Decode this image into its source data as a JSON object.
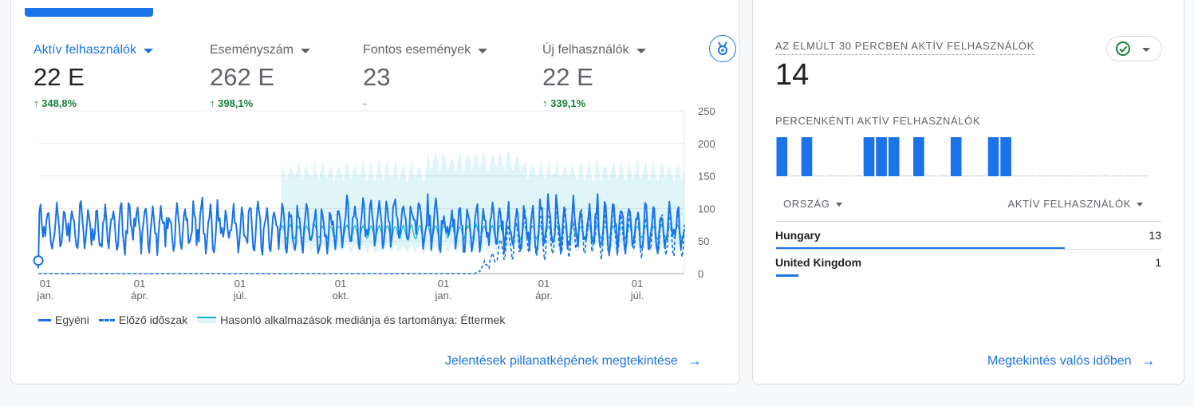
{
  "metrics": [
    {
      "label": "Aktív felhasználók",
      "value": "22 E",
      "delta": "↑ 348,8%",
      "active": true
    },
    {
      "label": "Eseményszám",
      "value": "262 E",
      "delta": "↑ 398,1%"
    },
    {
      "label": "Fontos események",
      "value": "23",
      "delta": "-"
    },
    {
      "label": "Új felhasználók",
      "value": "22 E",
      "delta": "↑ 339,1%"
    }
  ],
  "chart_data": {
    "type": "line",
    "y_axis": {
      "ticks": [
        "250",
        "200",
        "150",
        "100",
        "50",
        "0"
      ],
      "range": [
        0,
        250
      ]
    },
    "x_axis": {
      "ticks": [
        {
          "day": "01",
          "month": "jan."
        },
        {
          "day": "01",
          "month": "ápr."
        },
        {
          "day": "01",
          "month": "júl."
        },
        {
          "day": "01",
          "month": "okt."
        },
        {
          "day": "01",
          "month": "jan."
        },
        {
          "day": "01",
          "month": "ápr."
        },
        {
          "day": "01",
          "month": "júl."
        }
      ]
    },
    "series": [
      {
        "name": "Egyéni",
        "style": "solid",
        "color": "#1a73e8",
        "approx_range": [
          20,
          120
        ]
      },
      {
        "name": "Előző időszak",
        "style": "dashed",
        "color": "#1a73e8",
        "approx_range": [
          0,
          100
        ]
      },
      {
        "name": "Hasonló alkalmazások mediánja és tartománya: Éttermek",
        "style": "band",
        "color": "#12b5cb",
        "approx_median": 60,
        "approx_range": [
          30,
          160
        ]
      }
    ],
    "grid": true
  },
  "legend": [
    {
      "label": "Egyéni",
      "style": "solid"
    },
    {
      "label": "Előző időszak",
      "style": "dashed"
    },
    {
      "label": "Hasonló alkalmazások mediánja és tartománya: Éttermek",
      "style": "band"
    }
  ],
  "snapshot_link": "Jelentések pillanatképének megtekintése",
  "realtime": {
    "title": "AZ ELMÚLT 30 PERCBEN AKTÍV FELHASZNÁLÓK",
    "value": "14",
    "per_minute_title": "PERCENKÉNTI AKTÍV FELHASZNÁLÓK",
    "per_minute_values": [
      1,
      0,
      1,
      0,
      0,
      0,
      0,
      1,
      1,
      1,
      0,
      1,
      0,
      0,
      1,
      0,
      0,
      1,
      1,
      0,
      0,
      0,
      0,
      0,
      0,
      0,
      0,
      0,
      0,
      0
    ],
    "col_country": "ORSZÁG",
    "col_users": "AKTÍV FELHASZNÁLÓK",
    "rows": [
      {
        "country": "Hungary",
        "value": "13",
        "share": 0.9286
      },
      {
        "country": "United Kingdom",
        "value": "1",
        "share": 0.0714
      }
    ],
    "link": "Megtekintés valós időben"
  },
  "colors": {
    "accent": "#1a73e8",
    "positive": "#188038",
    "band": "#12b5cb"
  }
}
